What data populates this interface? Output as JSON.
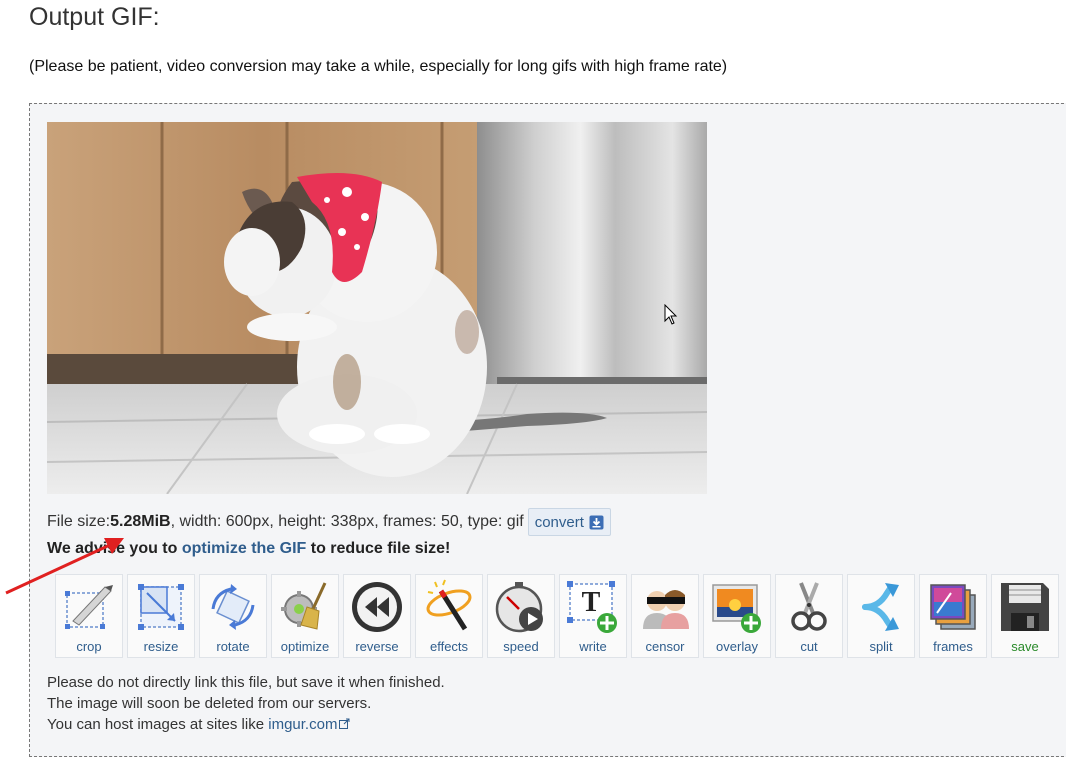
{
  "page": {
    "title": "Output GIF:",
    "note": "(Please be patient, video conversion may take a while, especially for long gifs with high frame rate)"
  },
  "file_info": {
    "prefix": "File size: ",
    "size": "5.28MiB",
    "details": ", width: 600px, height: 338px, frames: 50, type: gif",
    "convert_label": "convert"
  },
  "advice": {
    "before": "We advise you to ",
    "link": "optimize the GIF",
    "after": " to reduce file size!"
  },
  "tools": [
    {
      "label": "crop",
      "icon": "crop-icon"
    },
    {
      "label": "resize",
      "icon": "resize-icon"
    },
    {
      "label": "rotate",
      "icon": "rotate-icon"
    },
    {
      "label": "optimize",
      "icon": "optimize-icon"
    },
    {
      "label": "reverse",
      "icon": "reverse-icon"
    },
    {
      "label": "effects",
      "icon": "effects-icon"
    },
    {
      "label": "speed",
      "icon": "speed-icon"
    },
    {
      "label": "write",
      "icon": "write-icon"
    },
    {
      "label": "censor",
      "icon": "censor-icon"
    },
    {
      "label": "overlay",
      "icon": "overlay-icon"
    },
    {
      "label": "cut",
      "icon": "cut-icon"
    },
    {
      "label": "split",
      "icon": "split-icon"
    },
    {
      "label": "frames",
      "icon": "frames-icon"
    },
    {
      "label": "save",
      "icon": "save-icon"
    }
  ],
  "footer": {
    "line1": "Please do not directly link this file, but save it when finished.",
    "line2": "The image will soon be deleted from our servers.",
    "line3_prefix": "You can host images at sites like ",
    "link": "imgur.com"
  },
  "colors": {
    "link": "#2f5d8c",
    "save": "#2a8a2a",
    "panel_bg": "#f4f5f7",
    "arrow": "#e02020"
  }
}
